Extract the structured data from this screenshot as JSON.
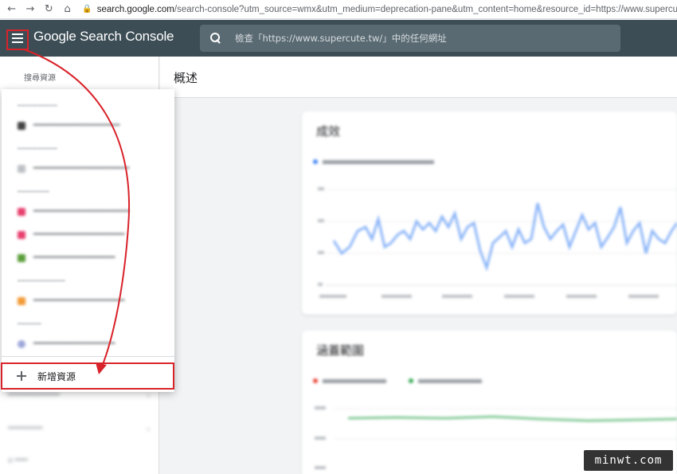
{
  "browser": {
    "url_host": "search.google.com",
    "url_path": "/search-console?utm_source=wmx&utm_medium=deprecation-pane&utm_content=home&resource_id=https://www.supercute.tw/"
  },
  "header": {
    "brand": "Google Search Console",
    "search_placeholder": "檢查「https://www.supercute.tw/」中的任何網址",
    "bg_color": "#3c4d55"
  },
  "left_nav": {
    "resource_label": "搜尋資源"
  },
  "main": {
    "page_title": "概述",
    "card1_title": "成效",
    "card2_title": "涵蓋範圍"
  },
  "dropdown": {
    "add_resource_label": "新增資源"
  },
  "watermark": "minwt.com",
  "colors": {
    "highlight": "#d8232a",
    "chart_line": "#8ab4f8",
    "chart_green": "#81c995"
  }
}
